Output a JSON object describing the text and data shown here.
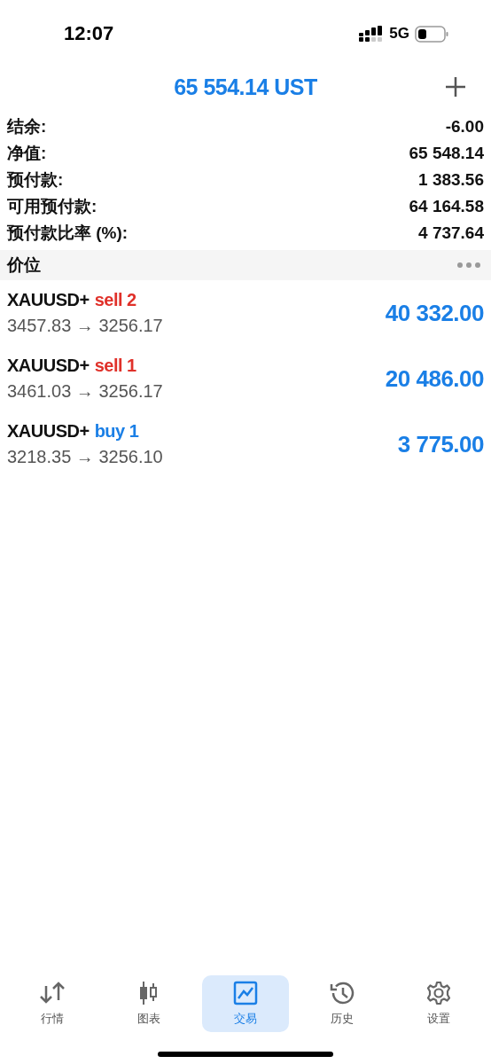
{
  "status_bar": {
    "time": "12:07",
    "network": "5G"
  },
  "header": {
    "title": "65 554.14 UST"
  },
  "summary": [
    {
      "label": "结余:",
      "value": "-6.00"
    },
    {
      "label": "净值:",
      "value": "65 548.14"
    },
    {
      "label": "预付款:",
      "value": "1 383.56"
    },
    {
      "label": "可用预付款:",
      "value": "64 164.58"
    },
    {
      "label": "预付款比率 (%):",
      "value": "4 737.64"
    }
  ],
  "positions_section": {
    "title": "价位"
  },
  "positions": [
    {
      "symbol": "XAUUSD+",
      "color": "#e0312a",
      "type": "sell 2",
      "prices": "3457.83 → 3256.17",
      "profit": "40 332.00"
    },
    {
      "symbol": "XAUUSD+",
      "color": "#e0312a",
      "type": "sell 1",
      "prices": "3461.03 → 3256.17",
      "profit": "20 486.00"
    },
    {
      "symbol": "XAUUSD+",
      "color": "#1a7fe6",
      "type": "buy 1",
      "prices": "3218.35 → 3256.10",
      "profit": "3 775.00"
    }
  ],
  "tabs": [
    {
      "label": "行情",
      "selected": false
    },
    {
      "label": "图表",
      "selected": false
    },
    {
      "label": "交易",
      "selected": true
    },
    {
      "label": "历史",
      "selected": false
    },
    {
      "label": "设置",
      "selected": false
    }
  ]
}
